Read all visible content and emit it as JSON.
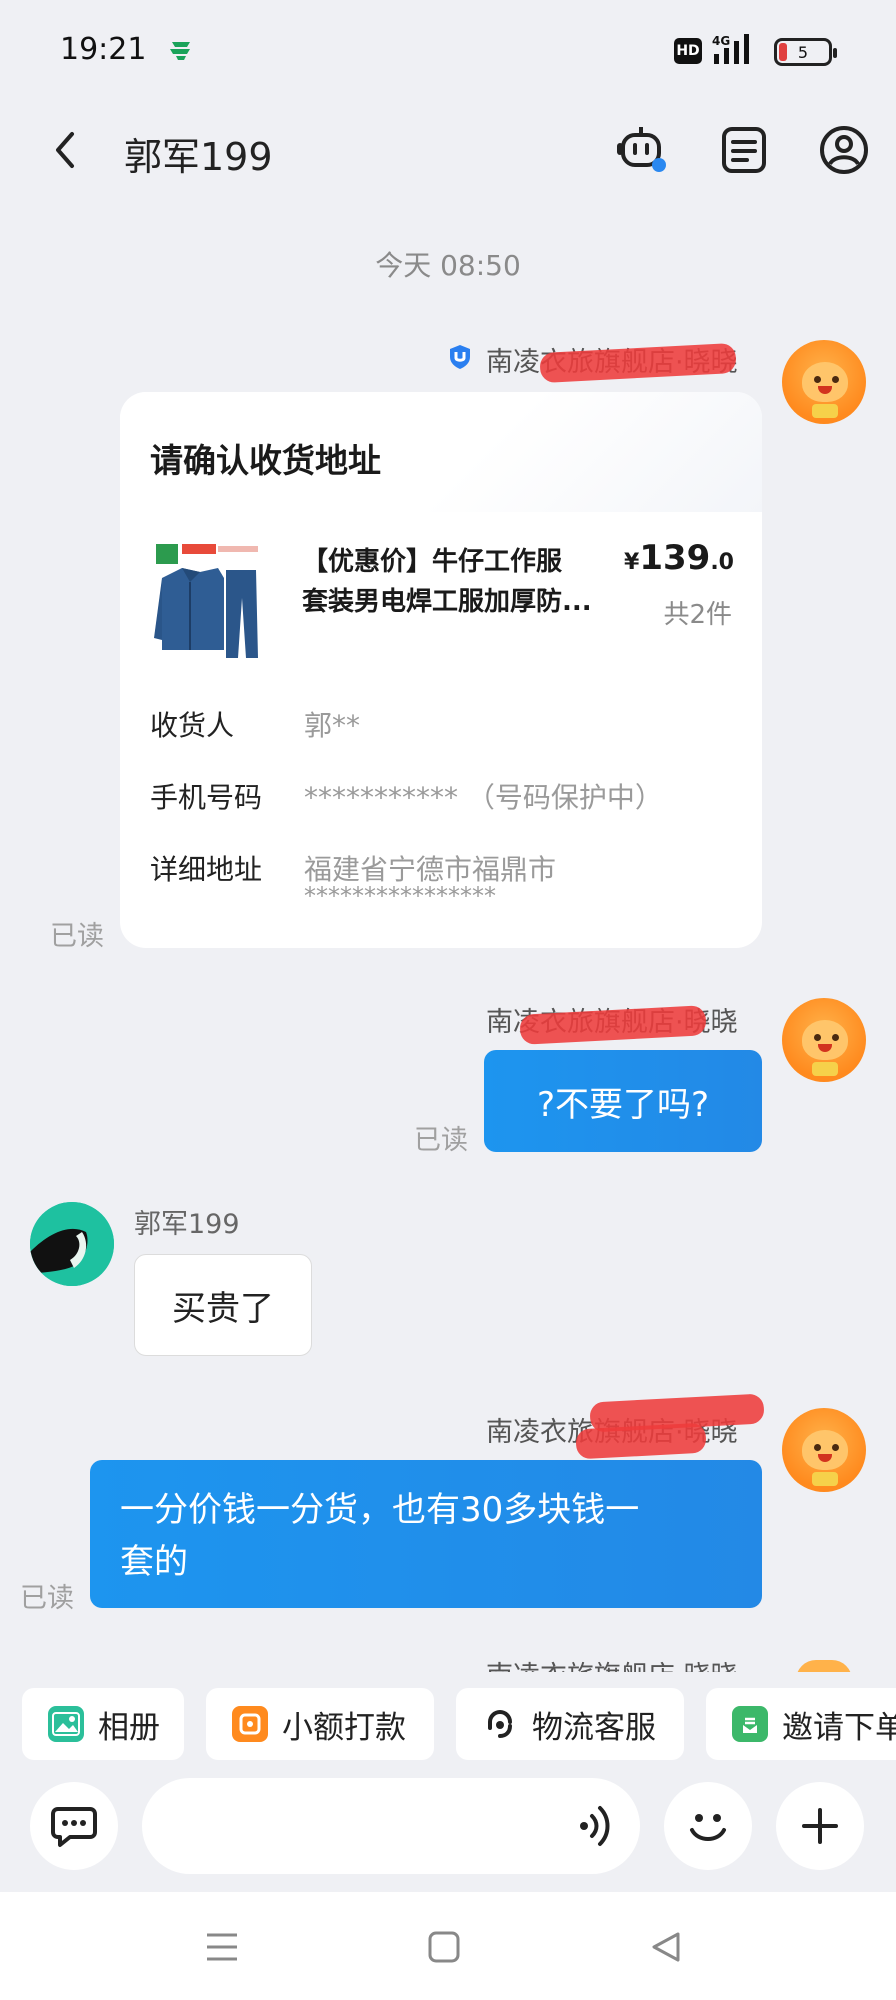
{
  "status_bar": {
    "time": "19:21",
    "hd": "HD",
    "network": "4G",
    "battery": "5"
  },
  "header": {
    "title": "郭军199",
    "back_icon": "chevron-left-icon",
    "icons": [
      "robot-icon",
      "notes-icon",
      "profile-icon"
    ]
  },
  "chat": {
    "time_divider": "今天  08:50",
    "read_label": "已读",
    "messages": [
      {
        "sender": "南凌衣旅旗舰店·晓晓",
        "type": "address_card",
        "card": {
          "title": "请确认收货地址",
          "product_name_line1": "【优惠价】牛仔工作服",
          "product_name_line2": "套装男电焊工服加厚防...",
          "price_currency": "¥",
          "price_int": "139",
          "price_dec": ".0",
          "count": "共2件",
          "fields": [
            {
              "label": "收货人",
              "value": "郭**"
            },
            {
              "label": "手机号码",
              "value": "*********** （号码保护中）"
            },
            {
              "label": "详细地址",
              "value": "福建省宁德市福鼎市",
              "value2": "****************"
            }
          ]
        }
      },
      {
        "sender": "南凌衣旅旗舰店·晓晓",
        "type": "text",
        "text": "?不要了吗?"
      },
      {
        "sender": "郭军199",
        "type": "text",
        "text": "买贵了"
      },
      {
        "sender": "南凌衣旅旗舰店·晓晓",
        "type": "text",
        "text_line1": "一分价钱一分货，也有30多块钱一",
        "text_line2": "套的"
      },
      {
        "sender": "南凌衣旅旗舰店·晓晓",
        "type": "partial"
      }
    ]
  },
  "quick_actions": [
    {
      "label": "相册",
      "icon": "image-icon",
      "color": "#2bbf9a"
    },
    {
      "label": "小额打款",
      "icon": "payment-icon",
      "color": "#ff8a1e"
    },
    {
      "label": "物流客服",
      "icon": "headset-icon",
      "color": "#222222"
    },
    {
      "label": "邀请下单",
      "icon": "invite-icon",
      "color": "#3cb86a"
    }
  ],
  "input": {
    "placeholder": "",
    "icons": [
      "chat-bubble-icon",
      "voice-icon",
      "emoji-icon",
      "plus-icon"
    ]
  },
  "nav": {
    "icons": [
      "menu-icon",
      "home-square-icon",
      "back-triangle-icon"
    ]
  },
  "colors": {
    "accent_blue": "#1d95ef",
    "background": "#eff0f4",
    "redaction": "#ee3b3b"
  }
}
